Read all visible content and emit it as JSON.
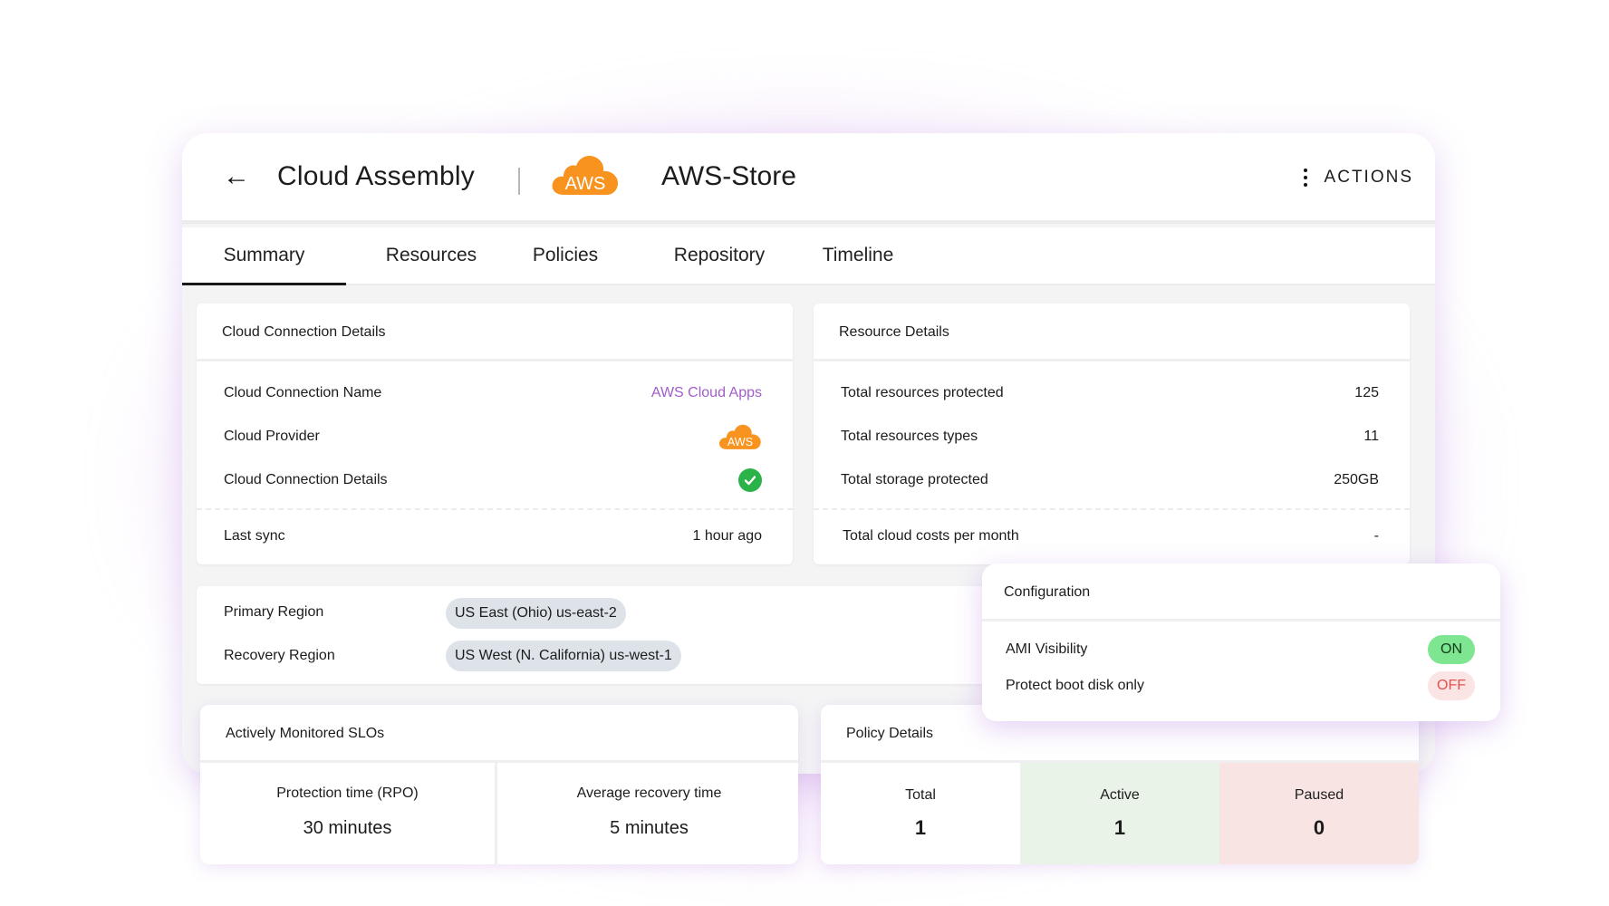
{
  "header": {
    "app_title": "Cloud Assembly",
    "store_title": "AWS-Store",
    "logo_text": "AWS",
    "actions_label": "ACTIONS"
  },
  "tabs": [
    {
      "label": "Summary",
      "active": true
    },
    {
      "label": "Resources",
      "active": false
    },
    {
      "label": "Policies",
      "active": false
    },
    {
      "label": "Repository",
      "active": false
    },
    {
      "label": "Timeline",
      "active": false
    }
  ],
  "cloud_connection": {
    "title": "Cloud Connection Details",
    "rows": [
      {
        "label": "Cloud Connection Name",
        "value": "AWS Cloud Apps"
      },
      {
        "label": "Cloud Provider",
        "value": "AWS"
      },
      {
        "label": "Cloud Connection Details",
        "value": "check"
      }
    ],
    "last_sync_label": "Last sync",
    "last_sync_value": "1 hour ago"
  },
  "resource_details": {
    "title": "Resource Details",
    "rows": [
      {
        "label": "Total resources protected",
        "value": "125"
      },
      {
        "label": "Total resources types",
        "value": "11"
      },
      {
        "label": "Total storage protected",
        "value": "250GB"
      }
    ],
    "cost_label": "Total cloud costs per month",
    "cost_value": "-"
  },
  "regions": {
    "primary_label": "Primary Region",
    "primary_value": "US East (Ohio) us-east-2",
    "recovery_label": "Recovery Region",
    "recovery_value": "US West (N. California) us-west-1"
  },
  "configuration": {
    "title": "Configuration",
    "items": [
      {
        "label": "AMI Visibility",
        "state": "ON"
      },
      {
        "label": "Protect boot disk only",
        "state": "OFF"
      }
    ]
  },
  "slos": {
    "title": "Actively Monitored SLOs",
    "items": [
      {
        "label": "Protection time (RPO)",
        "value": "30 minutes"
      },
      {
        "label": "Average recovery time",
        "value": "5 minutes"
      }
    ]
  },
  "policy_details": {
    "title": "Policy Details",
    "items": [
      {
        "label": "Total",
        "value": "1"
      },
      {
        "label": "Active",
        "value": "1"
      },
      {
        "label": "Paused",
        "value": "0"
      }
    ]
  },
  "colors": {
    "accent": "#a15dc8",
    "aws_orange": "#f7931e",
    "check_green": "#2bb34a",
    "on_green": "#7ee591",
    "off_red": "#e0524f",
    "active_bg": "#e9f3e7",
    "paused_bg": "#f8e4e2"
  }
}
